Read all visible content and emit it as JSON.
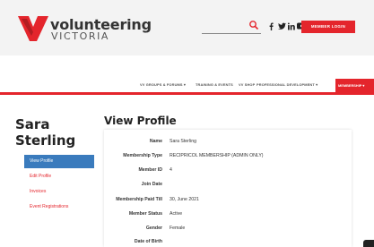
{
  "brand": {
    "line1": "volunteering",
    "line2": "VICTORIA",
    "accent": "#e4252c"
  },
  "header": {
    "search_placeholder": "",
    "social_icons": [
      "facebook-icon",
      "twitter-icon",
      "linkedin-icon",
      "youtube-icon"
    ],
    "login_label": "MEMBER LOGIN"
  },
  "nav": {
    "items": [
      {
        "label": "VV GROUPS & FORUMS ▾"
      },
      {
        "label": "TRAINING & EVENTS"
      },
      {
        "label": "VV SHOP"
      },
      {
        "label": "PROFESSIONAL DEVELOPMENT ▾"
      }
    ],
    "active_label": "MEMBERSHIP ▾"
  },
  "sidebar": {
    "user_name": "Sara Sterling",
    "items": [
      {
        "label": "View Profile"
      },
      {
        "label": "Edit Profile"
      },
      {
        "label": "Invoices"
      },
      {
        "label": "Event Registrations"
      }
    ]
  },
  "main": {
    "title": "View Profile",
    "fields": [
      {
        "label": "Name",
        "value": "Sara Sterling"
      },
      {
        "label": "Membership Type",
        "value": "RECIPRICOL MEMBERSHIP (ADMIN ONLY)"
      },
      {
        "label": "Member ID",
        "value": "4"
      },
      {
        "label": "Join Date",
        "value": ""
      },
      {
        "label": "Membership Paid Till",
        "value": "30, June 2021"
      },
      {
        "label": "Member Status",
        "value": "Active"
      },
      {
        "label": "Gender",
        "value": "Female"
      },
      {
        "label": "Date of Birth",
        "value": ""
      }
    ]
  }
}
